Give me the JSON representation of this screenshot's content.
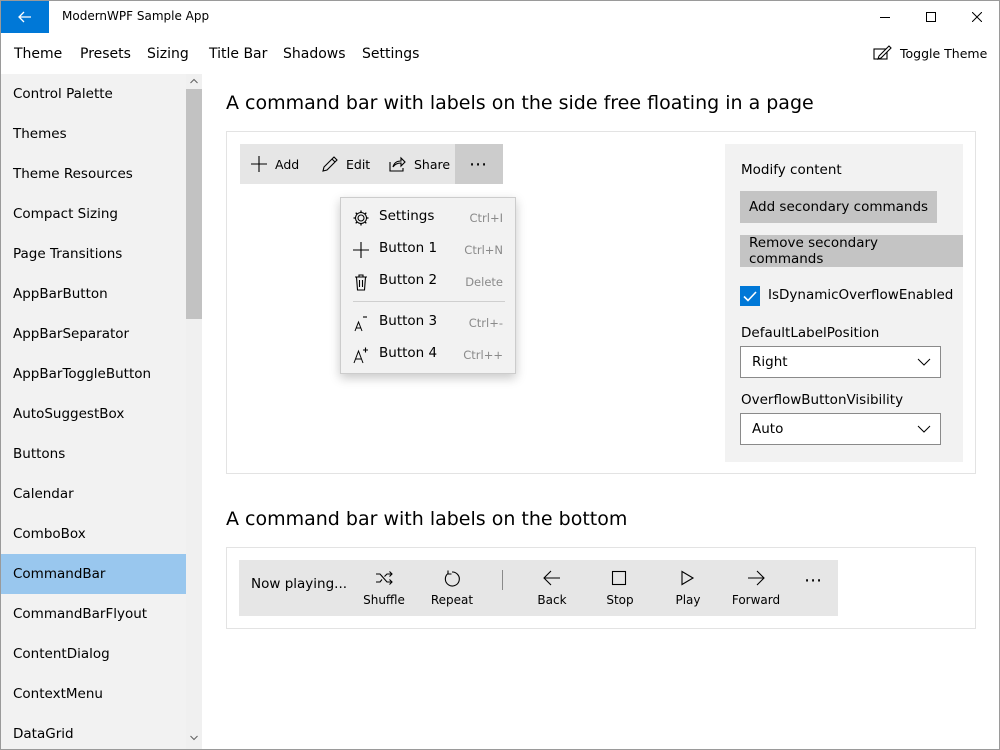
{
  "window": {
    "title": "ModernWPF Sample App"
  },
  "menubar": {
    "items": [
      "Theme",
      "Presets",
      "Sizing",
      "Title Bar",
      "Shadows",
      "Settings"
    ],
    "toggle_theme": "Toggle Theme"
  },
  "sidebar": {
    "items": [
      "Control Palette",
      "Themes",
      "Theme Resources",
      "Compact Sizing",
      "Page Transitions",
      "AppBarButton",
      "AppBarSeparator",
      "AppBarToggleButton",
      "AutoSuggestBox",
      "Buttons",
      "Calendar",
      "ComboBox",
      "CommandBar",
      "CommandBarFlyout",
      "ContentDialog",
      "ContextMenu",
      "DataGrid"
    ],
    "selected": "CommandBar"
  },
  "section1": {
    "title": "A command bar with labels on the side free floating in a page",
    "commands": [
      "Add",
      "Edit",
      "Share"
    ],
    "overflow": [
      {
        "label": "Settings",
        "key": "Ctrl+I"
      },
      {
        "label": "Button 1",
        "key": "Ctrl+N"
      },
      {
        "label": "Button 2",
        "key": "Delete"
      },
      {
        "label": "Button 3",
        "key": "Ctrl+-"
      },
      {
        "label": "Button 4",
        "key": "Ctrl++"
      }
    ],
    "panel": {
      "modify_label": "Modify content",
      "add_button": "Add secondary commands",
      "remove_button": "Remove secondary commands",
      "checkbox_label": "IsDynamicOverflowEnabled",
      "checkbox_checked": true,
      "label_position_label": "DefaultLabelPosition",
      "label_position_value": "Right",
      "overflow_visibility_label": "OverflowButtonVisibility",
      "overflow_visibility_value": "Auto"
    }
  },
  "section2": {
    "title": "A command bar with labels on the bottom",
    "content": "Now playing...",
    "commands": [
      "Shuffle",
      "Repeat",
      "Back",
      "Stop",
      "Play",
      "Forward"
    ]
  },
  "colors": {
    "accent": "#0078d7",
    "selected_nav": "#99c7ee",
    "sidebar_bg": "#f2f2f2",
    "commandbar_bg": "#e6e6e6"
  }
}
